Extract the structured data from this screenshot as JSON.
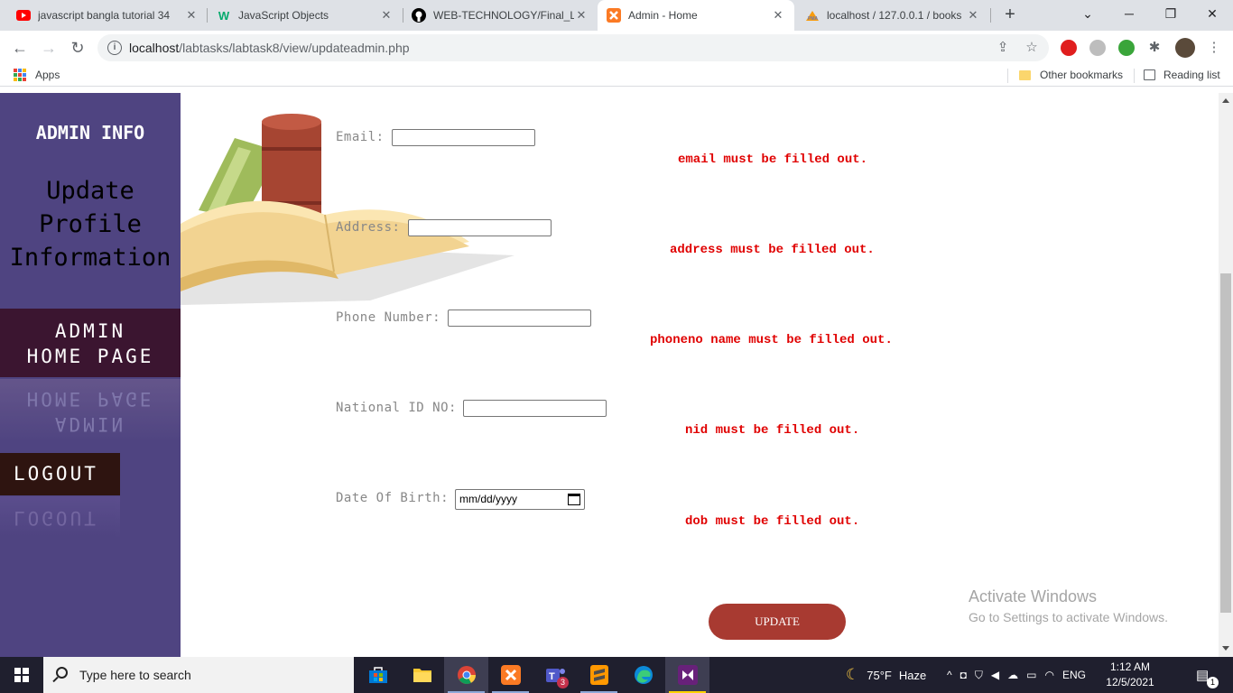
{
  "browser": {
    "tabs": [
      {
        "title": "javascript bangla tutorial 34",
        "favicon": "youtube-icon",
        "favicon_color": "#ff0000"
      },
      {
        "title": "JavaScript Objects",
        "favicon": "w3schools-icon",
        "favicon_color": "#04aa6d"
      },
      {
        "title": "WEB-TECHNOLOGY/Final_Lab",
        "favicon": "github-icon",
        "favicon_color": "#000000"
      },
      {
        "title": "Admin - Home",
        "favicon": "xampp-icon",
        "favicon_color": "#fb7a24"
      },
      {
        "title": "localhost / 127.0.0.1 / books",
        "favicon": "phpmyadmin-icon",
        "favicon_color": "#f89c0e"
      }
    ],
    "active_tab": 3,
    "new_tab_label": "+",
    "url_host": "localhost",
    "url_path": "/labtasks/labtask8/view/updateadmin.php",
    "bookmarks": {
      "apps": "Apps",
      "other": "Other bookmarks",
      "reading_list": "Reading list"
    }
  },
  "sidebar": {
    "title": "ADMIN INFO",
    "subtitle_lines": [
      "Update",
      "Profile",
      "Information"
    ],
    "home_lines": [
      "ADMIN",
      "HOME PAGE"
    ],
    "logout": "LOGOUT"
  },
  "form": {
    "fields": [
      {
        "label": "Email:",
        "error": "email must be filled out."
      },
      {
        "label": "Address:",
        "error": "address must be filled out."
      },
      {
        "label": "Phone Number:",
        "error": "phoneno name must be filled out."
      },
      {
        "label": "National ID NO:",
        "error": "nid must be filled out."
      },
      {
        "label": "Date Of Birth:",
        "error": "dob must be filled out.",
        "placeholder": "mm/dd/yyyy"
      }
    ],
    "submit": "UPDATE"
  },
  "watermark": {
    "line1": "Activate Windows",
    "line2": "Go to Settings to activate Windows."
  },
  "taskbar": {
    "search_placeholder": "Type here to search",
    "weather_temp": "75°F",
    "weather_desc": "Haze",
    "lang": "ENG",
    "time": "1:12 AM",
    "date": "12/5/2021",
    "teams_badge": "3",
    "notif_count": "1"
  },
  "colors": {
    "sidebar_bg": "#4f4481",
    "home_bg": "#3b1530",
    "logout_bg": "#2e1410",
    "error": "#e00000",
    "button": "#a83a31"
  }
}
